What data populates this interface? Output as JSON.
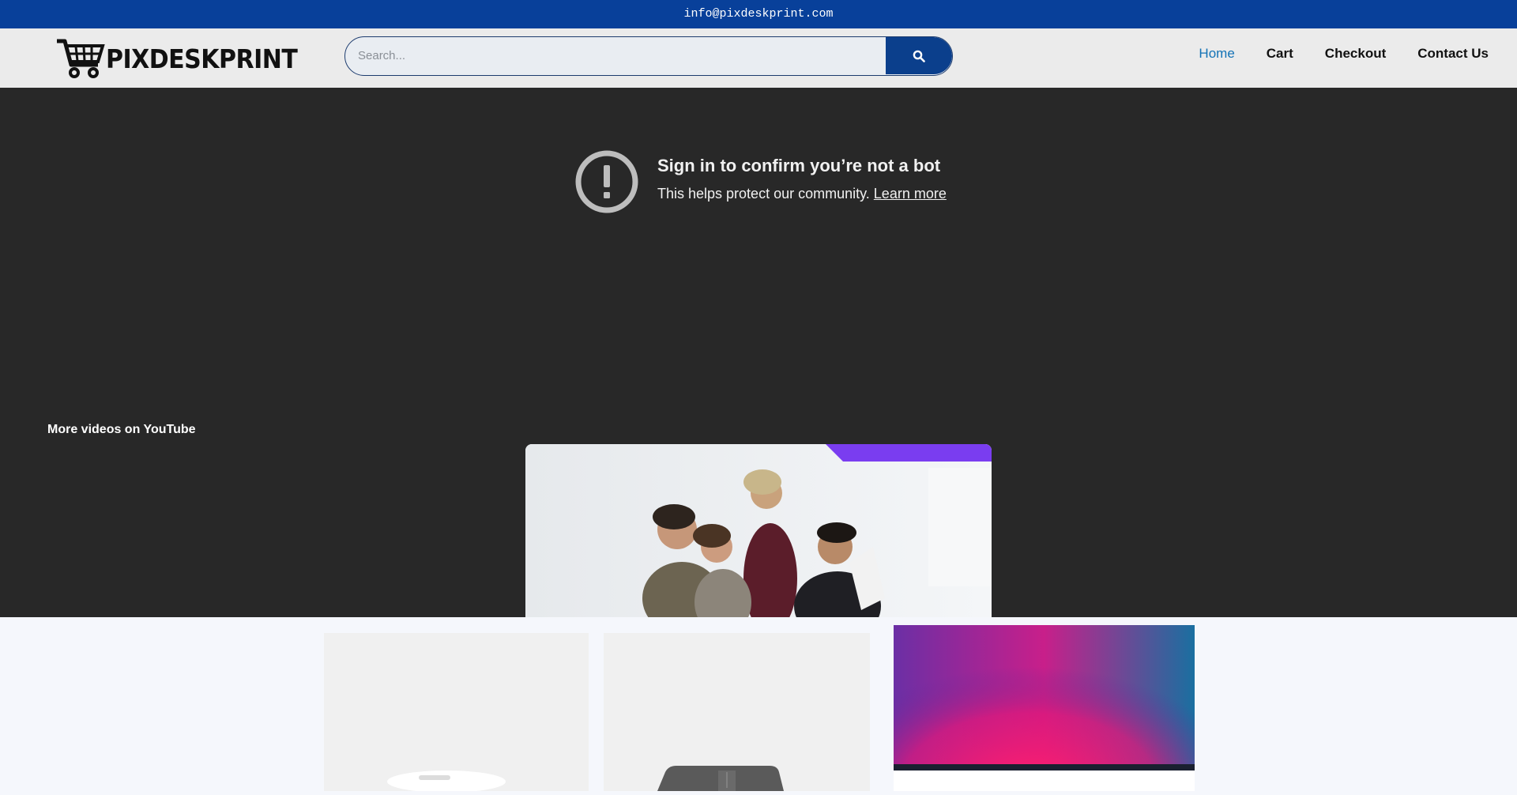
{
  "topbar": {
    "email": "info@pixdeskprint.com"
  },
  "header": {
    "logo_text": "PIXDESKPRINT",
    "search_placeholder": "Search...",
    "nav": [
      {
        "label": "Home",
        "active": true
      },
      {
        "label": "Cart"
      },
      {
        "label": "Checkout"
      },
      {
        "label": "Contact Us"
      }
    ]
  },
  "video": {
    "alert_title": "Sign in to confirm you’re not a bot",
    "alert_body": "This helps protect our community.",
    "alert_link": "Learn more",
    "more_videos": "More videos on YouTube"
  },
  "colors": {
    "topbar": "#08409a",
    "nav_active": "#1272b6",
    "video_bg": "#282828",
    "search_button": "#0b3f8c"
  },
  "icons": [
    "cart-logo-icon",
    "search-icon",
    "alert-icon"
  ]
}
